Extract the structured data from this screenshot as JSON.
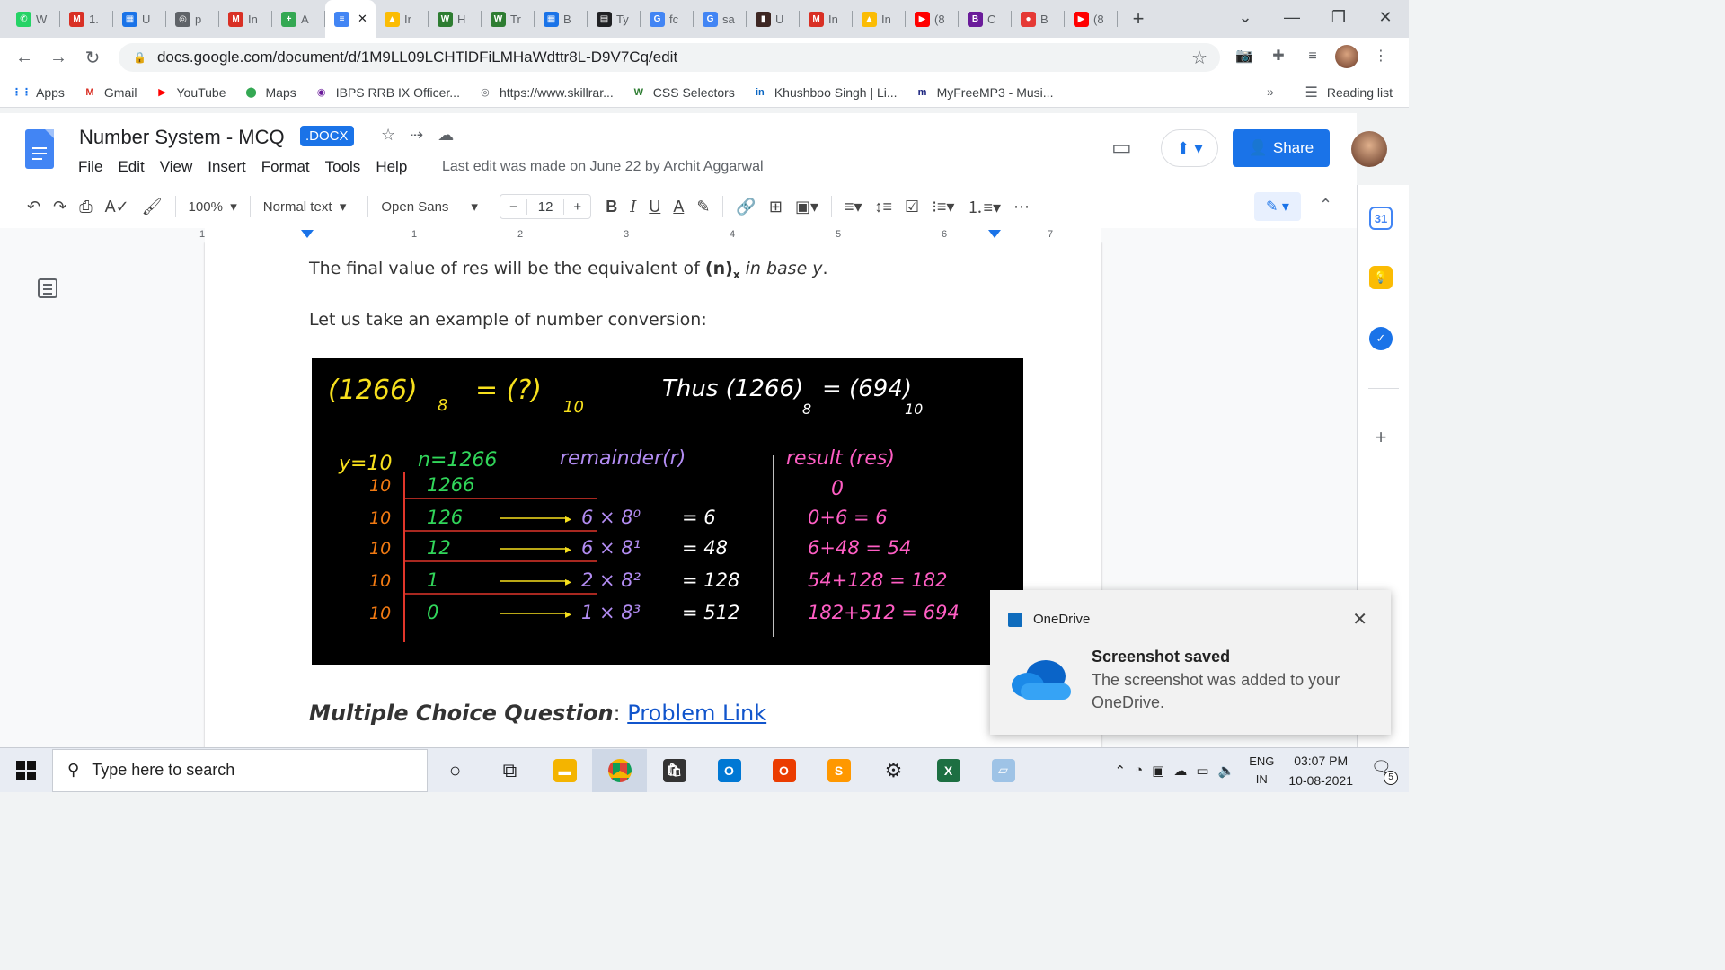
{
  "browser": {
    "tabs": [
      {
        "icon": "whatsapp-icon",
        "label": "W",
        "color": "#25d366",
        "glyph": "✆"
      },
      {
        "icon": "mail-icon",
        "label": "1.",
        "color": "#d93025",
        "glyph": "M"
      },
      {
        "icon": "app-icon",
        "label": "U",
        "color": "#1a73e8",
        "glyph": "▦"
      },
      {
        "icon": "globe-icon",
        "label": "p",
        "color": "#5f6368",
        "glyph": "◎"
      },
      {
        "icon": "gmail-icon",
        "label": "In",
        "color": "#d93025",
        "glyph": "M"
      },
      {
        "icon": "plus-app-icon",
        "label": "A",
        "color": "#34a853",
        "glyph": "+"
      },
      {
        "icon": "docs-icon",
        "label": "",
        "color": "#4285f4",
        "glyph": "≡",
        "active": true,
        "close": "✕"
      },
      {
        "icon": "drive-icon",
        "label": "Ir",
        "color": "#fbbc04",
        "glyph": "▲"
      },
      {
        "icon": "w3-icon",
        "label": "H",
        "color": "#2e7d32",
        "glyph": "W"
      },
      {
        "icon": "w3-icon",
        "label": "Tr",
        "color": "#2e7d32",
        "glyph": "W"
      },
      {
        "icon": "app-icon",
        "label": "B",
        "color": "#1a73e8",
        "glyph": "▦"
      },
      {
        "icon": "terminal-icon",
        "label": "Ty",
        "color": "#202124",
        "glyph": "▤"
      },
      {
        "icon": "google-icon",
        "label": "fc",
        "color": "#4285f4",
        "glyph": "G"
      },
      {
        "icon": "google-icon",
        "label": "sa",
        "color": "#4285f4",
        "glyph": "G"
      },
      {
        "icon": "book-icon",
        "label": "U",
        "color": "#3e2723",
        "glyph": "▮"
      },
      {
        "icon": "gmail-icon",
        "label": "In",
        "color": "#d93025",
        "glyph": "M"
      },
      {
        "icon": "drive-icon",
        "label": "In",
        "color": "#fbbc04",
        "glyph": "▲"
      },
      {
        "icon": "youtube-icon",
        "label": "(8",
        "color": "#ff0000",
        "glyph": "▶"
      },
      {
        "icon": "b-icon",
        "label": "C",
        "color": "#6a1b9a",
        "glyph": "B"
      },
      {
        "icon": "red-dot-icon",
        "label": "B",
        "color": "#e53935",
        "glyph": "●"
      },
      {
        "icon": "youtube-icon",
        "label": "(8",
        "color": "#ff0000",
        "glyph": "▶"
      }
    ],
    "new_tab": "+",
    "url": "docs.google.com/document/d/1M9LL09LCHTlDFiLMHaWdttr8L-D9V7Cq/edit",
    "bookmarks": [
      {
        "label": "Apps",
        "icon": "apps-grid-icon",
        "color": "#1a73e8",
        "glyph": "⋮⋮"
      },
      {
        "label": "Gmail",
        "icon": "gmail-icon",
        "color": "#d93025",
        "glyph": "M"
      },
      {
        "label": "YouTube",
        "icon": "youtube-icon",
        "color": "#ff0000",
        "glyph": "▶"
      },
      {
        "label": "Maps",
        "icon": "maps-pin-icon",
        "color": "#34a853",
        "glyph": "⬤"
      },
      {
        "label": "IBPS RRB IX Officer...",
        "icon": "site-icon",
        "color": "#6a1b9a",
        "glyph": "◉"
      },
      {
        "label": "https://www.skillrar...",
        "icon": "globe-icon",
        "color": "#5f6368",
        "glyph": "◎"
      },
      {
        "label": "CSS Selectors",
        "icon": "w3-icon",
        "color": "#2e7d32",
        "glyph": "W"
      },
      {
        "label": "Khushboo Singh | Li...",
        "icon": "linkedin-icon",
        "color": "#0a66c2",
        "glyph": "in"
      },
      {
        "label": "MyFreeMP3 - Musi...",
        "icon": "mp3-icon",
        "color": "#1a237e",
        "glyph": "m"
      }
    ],
    "bookmarks_more": "»",
    "reading_list": "Reading list"
  },
  "docs": {
    "title": "Number System - MCQ",
    "badge": ".DOCX",
    "menus": [
      "File",
      "Edit",
      "View",
      "Insert",
      "Format",
      "Tools",
      "Help"
    ],
    "last_edit": "Last edit was made on June 22 by Archit Aggarwal",
    "share_label": "Share",
    "toolbar": {
      "zoom": "100%",
      "style": "Normal text",
      "font": "Open Sans",
      "font_size": "12"
    },
    "ruler_numbers": [
      "1",
      "1",
      "2",
      "3",
      "4",
      "5",
      "6",
      "7"
    ]
  },
  "content": {
    "para1_prefix": "The final value of res will be the equivalent of ",
    "para1_bold": "(n)",
    "para1_sub": "x",
    "para1_italic": " in base y",
    "para1_end": ".",
    "para2": "Let us take an example of number conversion:",
    "mcq_label": "Multiple Choice Question",
    "mcq_colon": ": ",
    "mcq_link": "Problem Link",
    "board": {
      "title_left": "(1266)",
      "title_left_sub": "8",
      "title_eq": "= (?)",
      "title_eq_sub": "10",
      "thus": "Thus (1266)",
      "thus_sub": "8",
      "thus_eq": "= (694)",
      "thus_eq_sub": "10",
      "y_label": "y=10",
      "n_label": "n=1266",
      "rem_label": "remainder(r)",
      "res_label": "result (res)",
      "res_initial": "0",
      "divisors": [
        "10",
        "10",
        "10",
        "10",
        "10"
      ],
      "quotients": [
        "1266",
        "126",
        "12",
        "1",
        "0"
      ],
      "remainders": [
        "6 × 8⁰",
        "6 × 8¹",
        "2 × 8²",
        "1 × 8³"
      ],
      "products": [
        "= 6",
        "= 48",
        "= 128",
        "= 512"
      ],
      "results": [
        "0+6 = 6",
        "6+48 = 54",
        "54+128 = 182",
        "182+512 = 694"
      ],
      "colors": {
        "yellow": "#f7e01d",
        "green": "#31d65a",
        "orange": "#f27a12",
        "purple": "#b28cf2",
        "pink": "#ff5ec4",
        "white": "#ffffff",
        "red": "#e0362a"
      }
    }
  },
  "toast": {
    "app": "OneDrive",
    "title": "Screenshot saved",
    "message": "The screenshot was added to your OneDrive."
  },
  "taskbar": {
    "search_placeholder": "Type here to search",
    "lang_top": "ENG",
    "lang_bottom": "IN",
    "time": "03:07 PM",
    "date": "10-08-2021",
    "notifications": "5"
  }
}
